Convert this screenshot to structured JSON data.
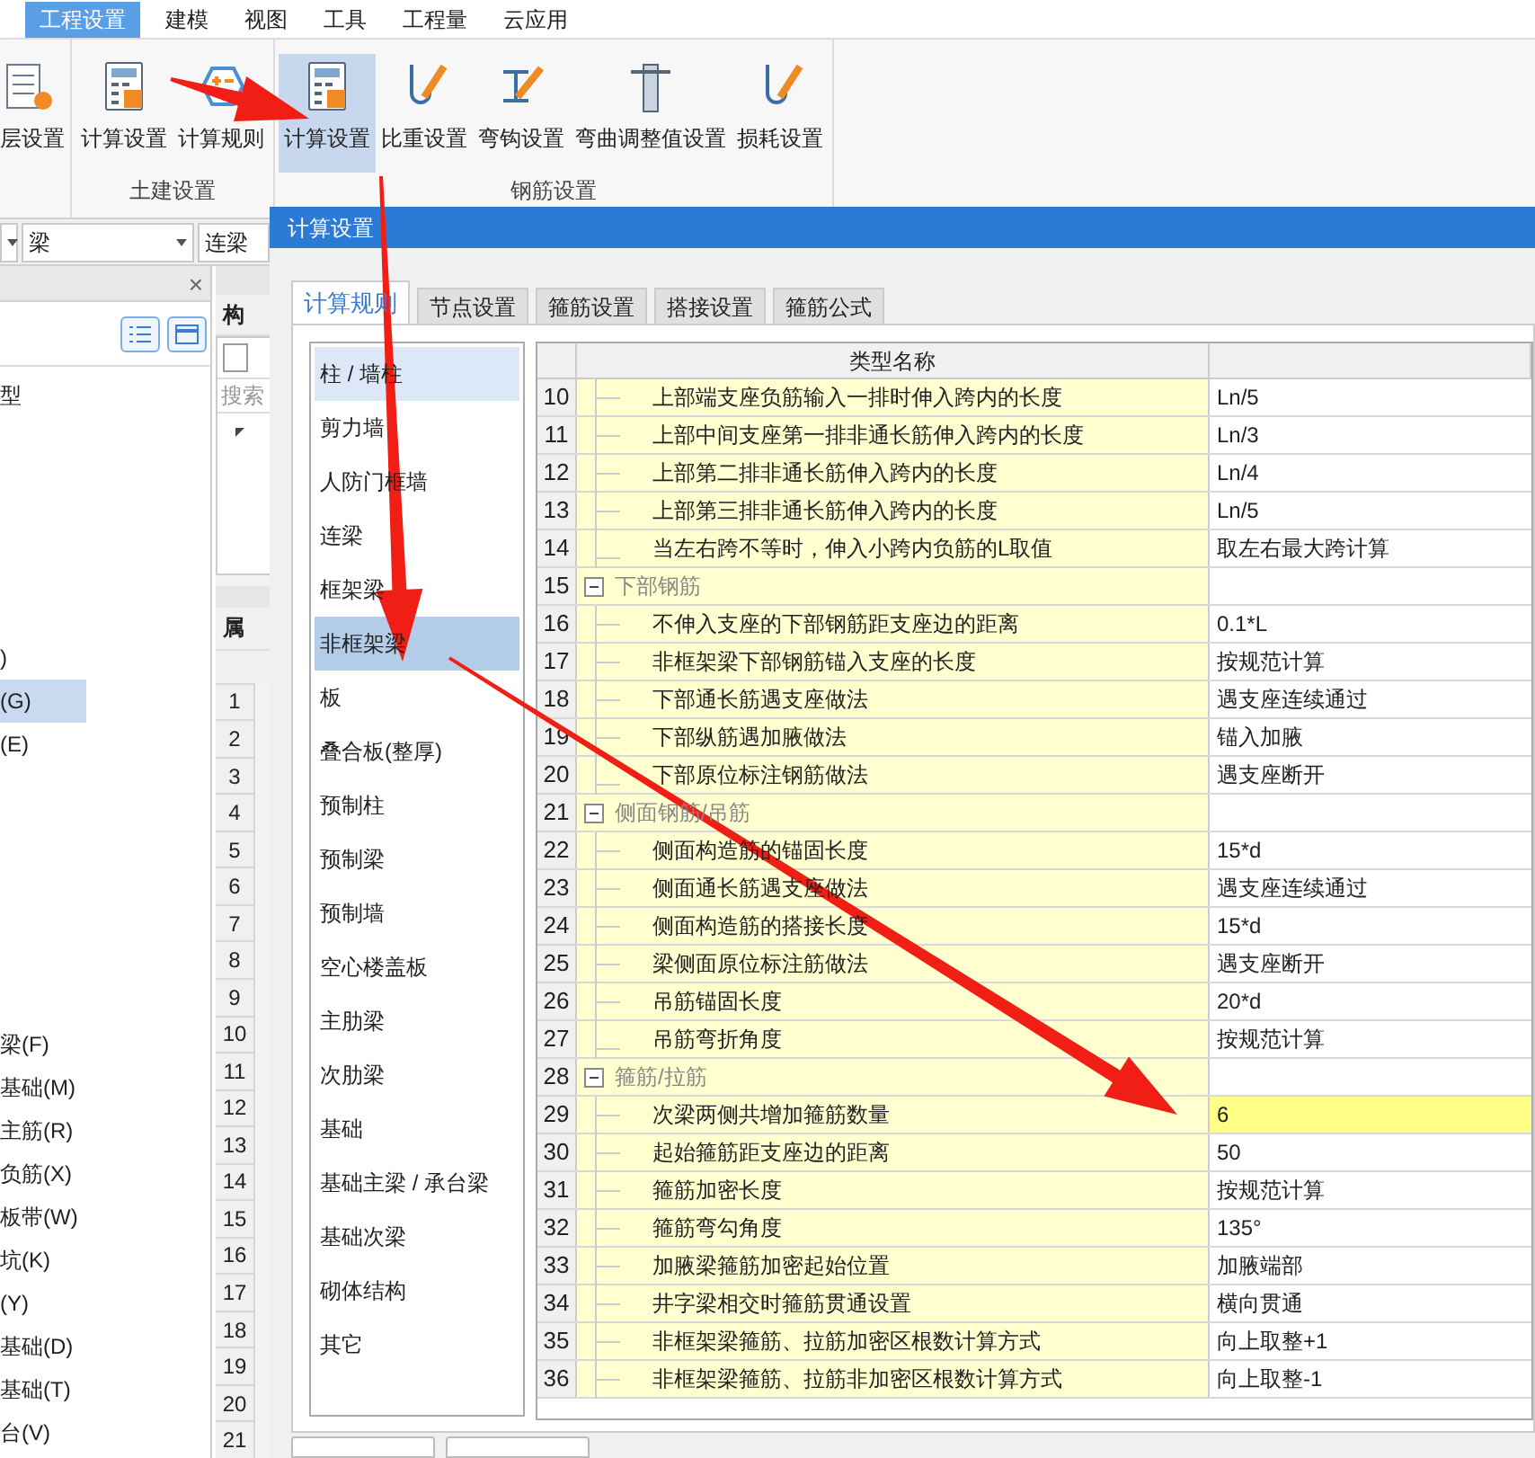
{
  "menu": [
    {
      "label": "工程设置",
      "selected": true
    },
    {
      "label": "建模",
      "selected": false
    },
    {
      "label": "视图",
      "selected": false
    },
    {
      "label": "工具",
      "selected": false
    },
    {
      "label": "工程量",
      "selected": false
    },
    {
      "label": "云应用",
      "selected": false
    }
  ],
  "ribbon": [
    {
      "buttons": [
        {
          "label": "层设置",
          "kind": "layers",
          "selected": false
        }
      ]
    },
    {
      "label": "土建设置",
      "buttons": [
        {
          "label": "计算设置",
          "kind": "calculator",
          "selected": false
        },
        {
          "label": "计算规则",
          "kind": "rule",
          "selected": false
        }
      ]
    },
    {
      "label": "钢筋设置",
      "buttons": [
        {
          "label": "计算设置",
          "kind": "calculator",
          "selected": true
        },
        {
          "label": "比重设置",
          "kind": "hook",
          "selected": false
        },
        {
          "label": "弯钩设置",
          "kind": "bend",
          "selected": false
        },
        {
          "label": "弯曲调整值设置",
          "kind": "column",
          "selected": false
        },
        {
          "label": "损耗设置",
          "kind": "hook",
          "selected": false
        }
      ]
    }
  ],
  "filters": [
    {
      "caret": true
    },
    {
      "label": "梁",
      "caret": true
    },
    {
      "label": "连梁",
      "caret": false
    }
  ],
  "left_panel": {
    "close": "×",
    "groups": [
      [
        {
          "label": "型",
          "selected": false
        }
      ],
      [
        {
          "label": ")",
          "selected": false
        },
        {
          "label": "(G)",
          "selected": true
        },
        {
          "label": "(E)",
          "selected": false
        }
      ],
      [
        {
          "label": "梁(F)",
          "selected": false
        },
        {
          "label": "基础(M)",
          "selected": false
        },
        {
          "label": "主筋(R)",
          "selected": false
        },
        {
          "label": "负筋(X)",
          "selected": false
        },
        {
          "label": "板带(W)",
          "selected": false
        },
        {
          "label": "坑(K)",
          "selected": false
        },
        {
          "label": "(Y)",
          "selected": false
        },
        {
          "label": "基础(D)",
          "selected": false
        },
        {
          "label": "基础(T)",
          "selected": false
        },
        {
          "label": "台(V)",
          "selected": false
        }
      ]
    ]
  },
  "middle_panel": {
    "header": "构",
    "search_placeholder": "搜索",
    "properties_header": "属",
    "row_numbers": [
      "1",
      "2",
      "3",
      "4",
      "5",
      "6",
      "7",
      "8",
      "9",
      "10",
      "11",
      "12",
      "13",
      "14",
      "15",
      "16",
      "17",
      "18",
      "19",
      "20",
      "21"
    ]
  },
  "dialog": {
    "title": "计算设置",
    "tabs": [
      {
        "label": "计算规则",
        "selected": true
      },
      {
        "label": "节点设置",
        "selected": false
      },
      {
        "label": "箍筋设置",
        "selected": false
      },
      {
        "label": "搭接设置",
        "selected": false
      },
      {
        "label": "箍筋公式",
        "selected": false
      }
    ],
    "categories": [
      {
        "label": "柱 / 墙柱",
        "selected": false,
        "hovered": true
      },
      {
        "label": "剪力墙",
        "selected": false,
        "hovered": false
      },
      {
        "label": "人防门框墙",
        "selected": false,
        "hovered": false
      },
      {
        "label": "连梁",
        "selected": false,
        "hovered": false
      },
      {
        "label": "框架梁",
        "selected": false,
        "hovered": false
      },
      {
        "label": "非框架梁",
        "selected": true,
        "hovered": false
      },
      {
        "label": "板",
        "selected": false,
        "hovered": false
      },
      {
        "label": "叠合板(整厚)",
        "selected": false,
        "hovered": false
      },
      {
        "label": "预制柱",
        "selected": false,
        "hovered": false
      },
      {
        "label": "预制梁",
        "selected": false,
        "hovered": false
      },
      {
        "label": "预制墙",
        "selected": false,
        "hovered": false
      },
      {
        "label": "空心楼盖板",
        "selected": false,
        "hovered": false
      },
      {
        "label": "主肋梁",
        "selected": false,
        "hovered": false
      },
      {
        "label": "次肋梁",
        "selected": false,
        "hovered": false
      },
      {
        "label": "基础",
        "selected": false,
        "hovered": false
      },
      {
        "label": "基础主梁 / 承台梁",
        "selected": false,
        "hovered": false
      },
      {
        "label": "基础次梁",
        "selected": false,
        "hovered": false
      },
      {
        "label": "砌体结构",
        "selected": false,
        "hovered": false
      },
      {
        "label": "其它",
        "selected": false,
        "hovered": false
      }
    ],
    "table": {
      "columns": [
        {},
        {
          "label": "类型名称"
        },
        {}
      ],
      "rows": [
        {
          "kind": "item",
          "number": "10",
          "name": "上部端支座负筋输入一排时伸入跨内的长度",
          "value": "Ln/5",
          "selected": false
        },
        {
          "kind": "item",
          "number": "11",
          "name": "上部中间支座第一排非通长筋伸入跨内的长度",
          "value": "Ln/3",
          "selected": false
        },
        {
          "kind": "item",
          "number": "12",
          "name": "上部第二排非通长筋伸入跨内的长度",
          "value": "Ln/4",
          "selected": false
        },
        {
          "kind": "item",
          "number": "13",
          "name": "上部第三排非通长筋伸入跨内的长度",
          "value": "Ln/5",
          "selected": false
        },
        {
          "kind": "last",
          "number": "14",
          "name": "当左右跨不等时，伸入小跨内负筋的L取值",
          "value": "取左右最大跨计算",
          "selected": false
        },
        {
          "kind": "group",
          "number": "15",
          "name": "下部钢筋",
          "expanded": true
        },
        {
          "kind": "item",
          "number": "16",
          "name": "不伸入支座的下部钢筋距支座边的距离",
          "value": "0.1*L",
          "selected": false
        },
        {
          "kind": "item",
          "number": "17",
          "name": "非框架梁下部钢筋锚入支座的长度",
          "value": "按规范计算",
          "selected": false
        },
        {
          "kind": "item",
          "number": "18",
          "name": "下部通长筋遇支座做法",
          "value": "遇支座连续通过",
          "selected": false
        },
        {
          "kind": "item",
          "number": "19",
          "name": "下部纵筋遇加腋做法",
          "value": "锚入加腋",
          "selected": false
        },
        {
          "kind": "last",
          "number": "20",
          "name": "下部原位标注钢筋做法",
          "value": "遇支座断开",
          "selected": false
        },
        {
          "kind": "group",
          "number": "21",
          "name": "侧面钢筋/吊筋",
          "expanded": true
        },
        {
          "kind": "item",
          "number": "22",
          "name": "侧面构造筋的锚固长度",
          "value": "15*d",
          "selected": false
        },
        {
          "kind": "item",
          "number": "23",
          "name": "侧面通长筋遇支座做法",
          "value": "遇支座连续通过",
          "selected": false
        },
        {
          "kind": "item",
          "number": "24",
          "name": "侧面构造筋的搭接长度",
          "value": "15*d",
          "selected": false
        },
        {
          "kind": "item",
          "number": "25",
          "name": "梁侧面原位标注筋做法",
          "value": "遇支座断开",
          "selected": false
        },
        {
          "kind": "item",
          "number": "26",
          "name": "吊筋锚固长度",
          "value": "20*d",
          "selected": false
        },
        {
          "kind": "last",
          "number": "27",
          "name": "吊筋弯折角度",
          "value": "按规范计算",
          "selected": false
        },
        {
          "kind": "group",
          "number": "28",
          "name": "箍筋/拉筋",
          "expanded": true
        },
        {
          "kind": "item",
          "number": "29",
          "name": "次梁两侧共增加箍筋数量",
          "value": "6",
          "selected": true
        },
        {
          "kind": "item",
          "number": "30",
          "name": "起始箍筋距支座边的距离",
          "value": "50",
          "selected": false
        },
        {
          "kind": "item",
          "number": "31",
          "name": "箍筋加密长度",
          "value": "按规范计算",
          "selected": false
        },
        {
          "kind": "item",
          "number": "32",
          "name": "箍筋弯勾角度",
          "value": "135°",
          "selected": false
        },
        {
          "kind": "item",
          "number": "33",
          "name": "加腋梁箍筋加密起始位置",
          "value": "加腋端部",
          "selected": false
        },
        {
          "kind": "item",
          "number": "34",
          "name": "井字梁相交时箍筋贯通设置",
          "value": "横向贯通",
          "selected": false
        },
        {
          "kind": "item",
          "number": "35",
          "name": "非框架梁箍筋、拉筋加密区根数计算方式",
          "value": "向上取整+1",
          "selected": false
        },
        {
          "kind": "item",
          "number": "36",
          "name": "非框架梁箍筋、拉筋非加密区根数计算方式",
          "value": "向上取整-1",
          "selected": false
        }
      ]
    }
  }
}
